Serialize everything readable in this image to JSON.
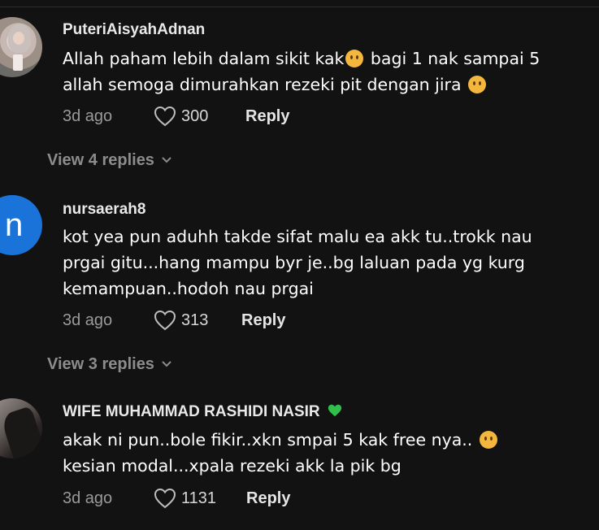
{
  "comments": [
    {
      "username": "PuteriAisyahAdnan",
      "line1": "Allah paham lebih dalam sikit kak",
      "line1_tail": "bagi 1 nak sampai 5",
      "line2": "allah semoga dimurahkan rezeki pit dengan jira",
      "time": "3d ago",
      "likes": "300",
      "reply_label": "Reply",
      "view_replies": "View 4 replies",
      "emoji_1": "pleading-face-icon",
      "emoji_2": "smiling-face-with-hearts-icon"
    },
    {
      "username": "nursaerah8",
      "avatar_letter": "n",
      "avatar_color": "#1a73d9",
      "line1": "kot yea pun aduhh takde sifat malu ea akk tu..trokk nau",
      "line2": "prgai gitu...hang mampu byr je..bg laluan pada yg kurg",
      "line3": "kemampuan..hodoh nau prgai",
      "time": "3d ago",
      "likes": "313",
      "reply_label": "Reply",
      "view_replies": "View 3 replies"
    },
    {
      "username": "WIFE MUHAMMAD RASHIDI NASIR",
      "username_badge": "green-heart-icon",
      "line1": "akak ni pun..bole fikir..xkn smpai 5 kak free nya..",
      "line2": "kesian modal...xpala rezeki akk la pik bg",
      "time": "3d ago",
      "likes": "1131",
      "reply_label": "Reply",
      "emoji_1": "pensive-face-icon"
    }
  ],
  "colors": {
    "background": "#121212",
    "username": "#e9e9e9",
    "meta": "#9a9a9a",
    "badge_green": "#2fbf4a"
  }
}
